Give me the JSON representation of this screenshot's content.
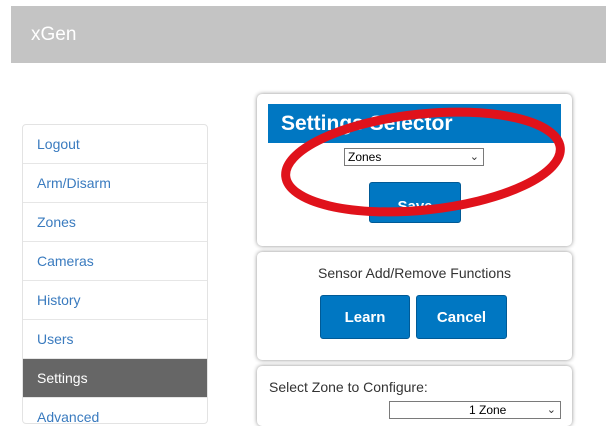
{
  "app": {
    "title": "xGen"
  },
  "sidebar": {
    "items": [
      {
        "label": "Logout"
      },
      {
        "label": "Arm/Disarm"
      },
      {
        "label": "Zones"
      },
      {
        "label": "Cameras"
      },
      {
        "label": "History"
      },
      {
        "label": "Users"
      },
      {
        "label": "Settings",
        "active": true
      },
      {
        "label": "Advanced"
      }
    ]
  },
  "settings_selector": {
    "title": "Settings Selector",
    "select_value": "Zones",
    "save_label": "Save"
  },
  "sensor_functions": {
    "title": "Sensor Add/Remove Functions",
    "learn_label": "Learn",
    "cancel_label": "Cancel"
  },
  "zone_config": {
    "label": "Select Zone to Configure:",
    "select_value": "1 Zone"
  },
  "colors": {
    "accent": "#0077c2",
    "header_bg": "#c4c4c4",
    "sidebar_active": "#666666",
    "link": "#3a7bbf",
    "annotation": "#e0121b"
  }
}
